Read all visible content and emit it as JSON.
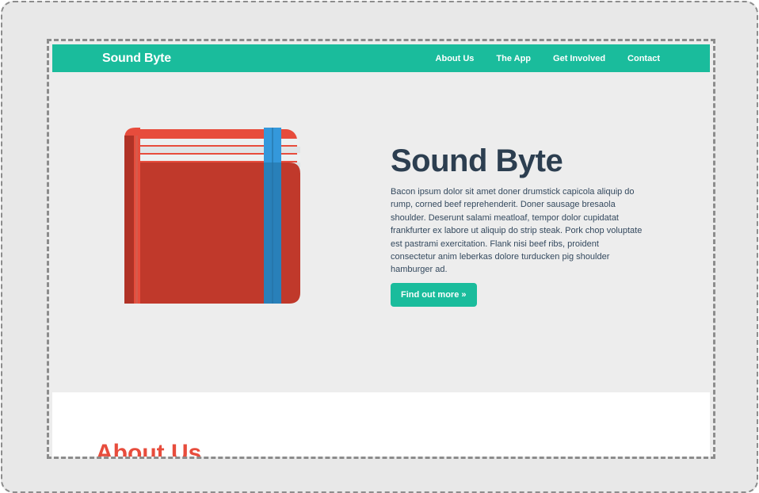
{
  "navbar": {
    "brand": "Sound Byte",
    "links": [
      "About Us",
      "The App",
      "Get Involved",
      "Contact"
    ]
  },
  "hero": {
    "title": "Sound Byte",
    "text": "Bacon ipsum dolor sit amet doner drumstick capicola aliquip do rump, corned beef reprehenderit. Doner sausage bresaola shoulder. Deserunt salami meatloaf, tempor dolor cupidatat frankfurter ex labore ut aliquip do strip steak. Pork chop voluptate est pastrami exercitation. Flank nisi beef ribs, proident consectetur anim leberkas dolore turducken pig shoulder hamburger ad.",
    "button_label": "Find out more »",
    "image_icon": "book-icon"
  },
  "about": {
    "title": "About Us"
  },
  "colors": {
    "brand": "#1abc9c",
    "heading": "#2c3e50",
    "about_heading": "#e74c3c",
    "book_cover": "#c0392b",
    "bookmark": "#2d8ad6"
  }
}
